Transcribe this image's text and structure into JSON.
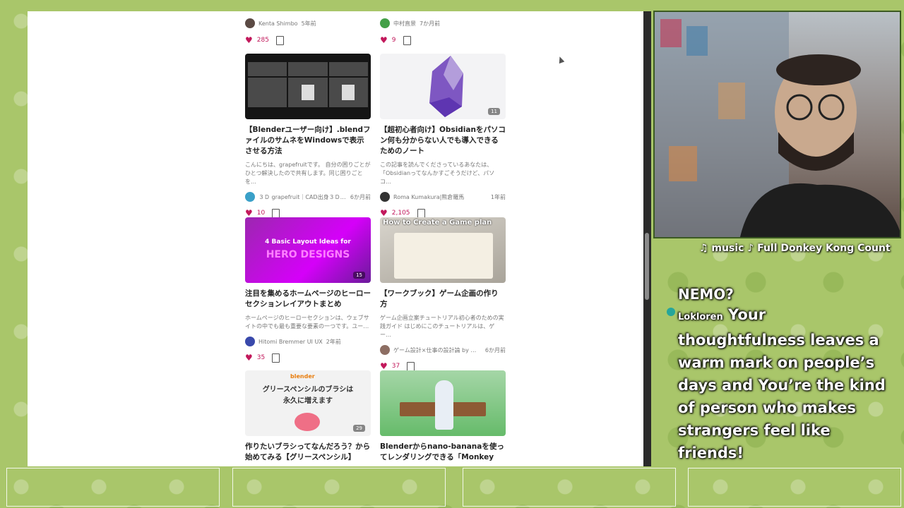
{
  "colors": {
    "heart": "#c2185b",
    "accent": "#7e57c2"
  },
  "top_row": [
    {
      "author": "Kenta Shimbo",
      "time": "5年前",
      "likes": "285"
    },
    {
      "author": "中村直景",
      "time": "7か月前",
      "likes": "9"
    }
  ],
  "articles": [
    {
      "title": "【Blenderユーザー向け】.blendファイルのサムネをWindowsで表示させる方法",
      "excerpt": "こんにちは、grapefruitです。 自分の困りごとがひとつ解決したので共有します。同じ困りごとを…",
      "author": "３Ｄ grapefruit｜CAD出身３ＤモＮ",
      "time": "6か月前",
      "likes": "10"
    },
    {
      "title": "【超初心者向け】Obsidianをパソコン何も分からない人でも導入できるためのノート",
      "excerpt": "この記事を読んでくださっているあなたは、「Obsidianってなんかすごそうだけど、パソコ…",
      "author": "Roma Kumakura|熊倉羅馬",
      "time": "1年前",
      "likes": "2,105",
      "badge": "11"
    },
    {
      "title": "注目を集めるホームページのヒーローセクションレイアウトまとめ",
      "excerpt": "ホームページのヒーローセクションは、ウェブサイトの中でも最も重要な要素の一つです。ユー…",
      "author": "Hitomi Bremmer UI UX",
      "time": "2年前",
      "likes": "35",
      "badge": "15",
      "thumb_line1": "4 Basic Layout Ideas for",
      "thumb_line2": "HERO DESIGNS"
    },
    {
      "title": "【ワークブック】ゲーム企画の作り方",
      "excerpt": "ゲーム企画立案チュートリアル初心者のための実践ガイド はじめにこのチュートリアルは、ゲー…",
      "author": "ゲーム設計×仕事の設計論 by う…",
      "time": "6か月前",
      "likes": "37",
      "thumb_text": "How to Create a Game plan"
    },
    {
      "title": "作りたいブラシってなんだろう？から始めてみる【グリースペンシル】",
      "badge": "29",
      "thumb_brand": "blender",
      "thumb_line1": "グリースペンシルのブラシは",
      "thumb_line2": "永久に増えます"
    },
    {
      "title": "Blenderからnano-bananaを使ってレンダリングできる「Monkey"
    }
  ],
  "stream": {
    "music": "♫ music ♪ Full Donkey Kong Count",
    "chat_prev": "NEMO?",
    "chat_user": "Lokloren",
    "chat_message": "Your thoughtfulness leaves a warm mark on people’s days and You’re the kind of person who makes strangers feel like friends!"
  }
}
